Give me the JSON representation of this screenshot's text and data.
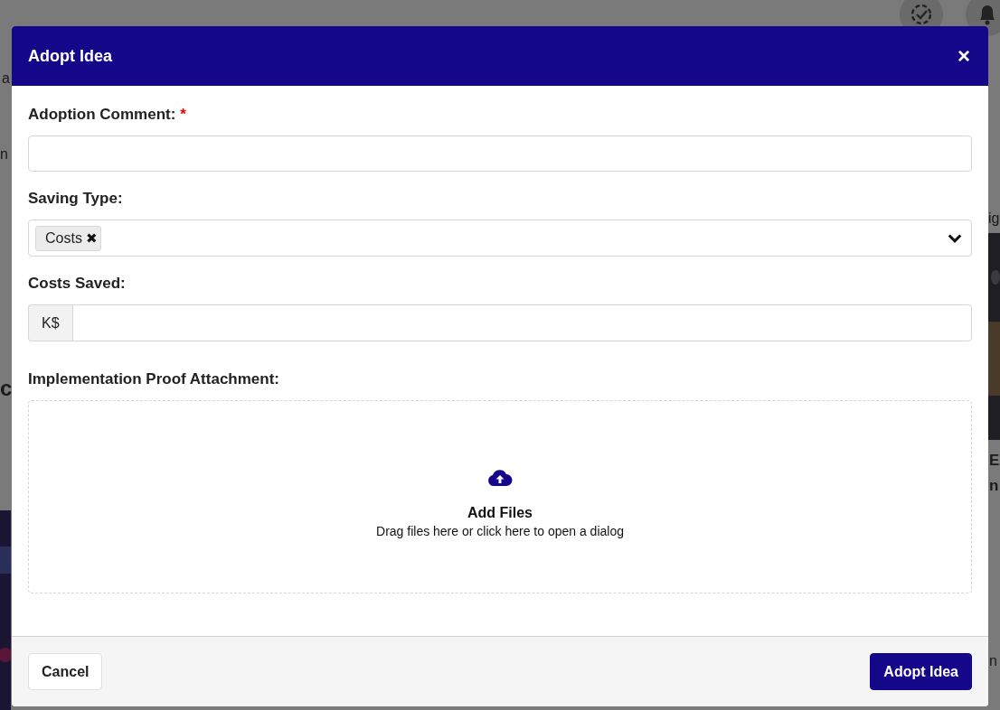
{
  "background": {
    "fragments": [
      {
        "text": "a"
      },
      {
        "text": "n"
      },
      {
        "text": "c"
      },
      {
        "text": "ig"
      },
      {
        "text": "E"
      },
      {
        "text": "n"
      },
      {
        "text": "n"
      }
    ]
  },
  "dialog": {
    "title": "Adopt Idea",
    "close": "×",
    "fields": [
      {
        "kind": "text",
        "label": "Adoption Comment:",
        "required_mark": "*"
      },
      {
        "kind": "multiselect",
        "label": "Saving Type:",
        "tags": [
          {
            "label": "Costs",
            "remove": "✖"
          }
        ]
      },
      {
        "kind": "addon",
        "label": "Costs Saved:",
        "addon": "K$"
      },
      {
        "kind": "dropzone",
        "label": "Implementation Proof Attachment:",
        "title": "Add Files",
        "hint": "Drag files here or click here to open a dialog"
      }
    ],
    "buttons": [
      {
        "label": "Cancel",
        "primary": false
      },
      {
        "label": "Adopt Idea",
        "primary": true
      }
    ]
  }
}
